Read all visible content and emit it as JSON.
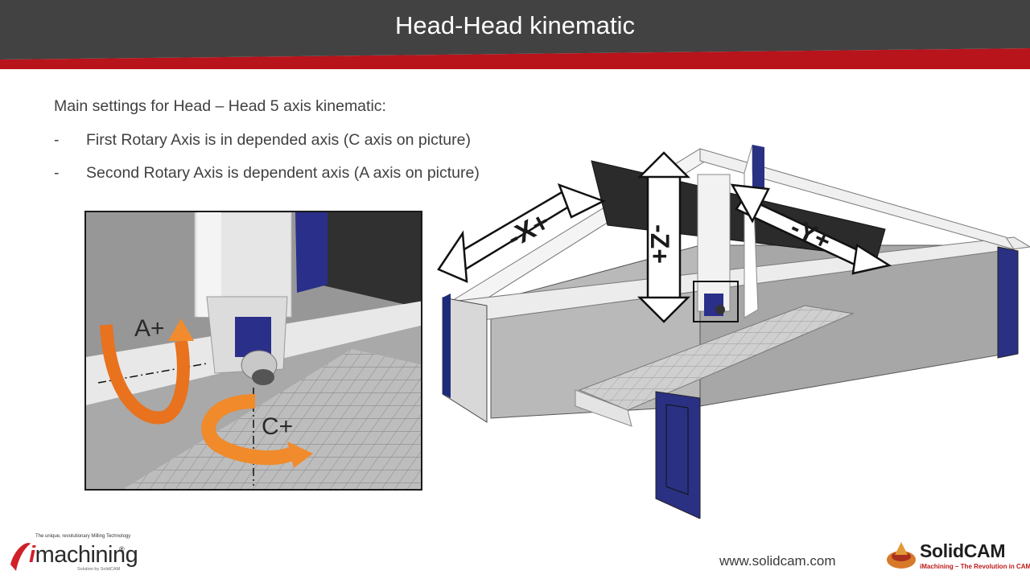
{
  "slide": {
    "title": "Head-Head kinematic",
    "intro": "Main settings for Head – Head 5 axis kinematic:",
    "bullets": [
      {
        "dash": "-",
        "text": "First Rotary Axis is in depended axis (C axis on picture)"
      },
      {
        "dash": "-",
        "text": "Second Rotary Axis is dependent axis (A axis on picture)"
      }
    ]
  },
  "inset": {
    "label_a": "A+",
    "label_c": "C+"
  },
  "machine": {
    "label_x": "-X+",
    "label_y": "-Y+",
    "label_z": "-Z+"
  },
  "footer": {
    "url": "www.solidcam.com",
    "imachining": {
      "tagline": "The unique, revolutionary Milling Technology",
      "i": "i",
      "word": "machining",
      "reg": "®",
      "sub": "Solution by SolidCAM"
    },
    "solidcam": {
      "name": "SolidCAM",
      "tagline": "iMachining – The Revolution in CAM!"
    }
  },
  "colors": {
    "header_dark": "#3f3f3f",
    "header_red": "#b8141c",
    "arrow_orange": "#e8721e",
    "machine_blue": "#22237a"
  }
}
